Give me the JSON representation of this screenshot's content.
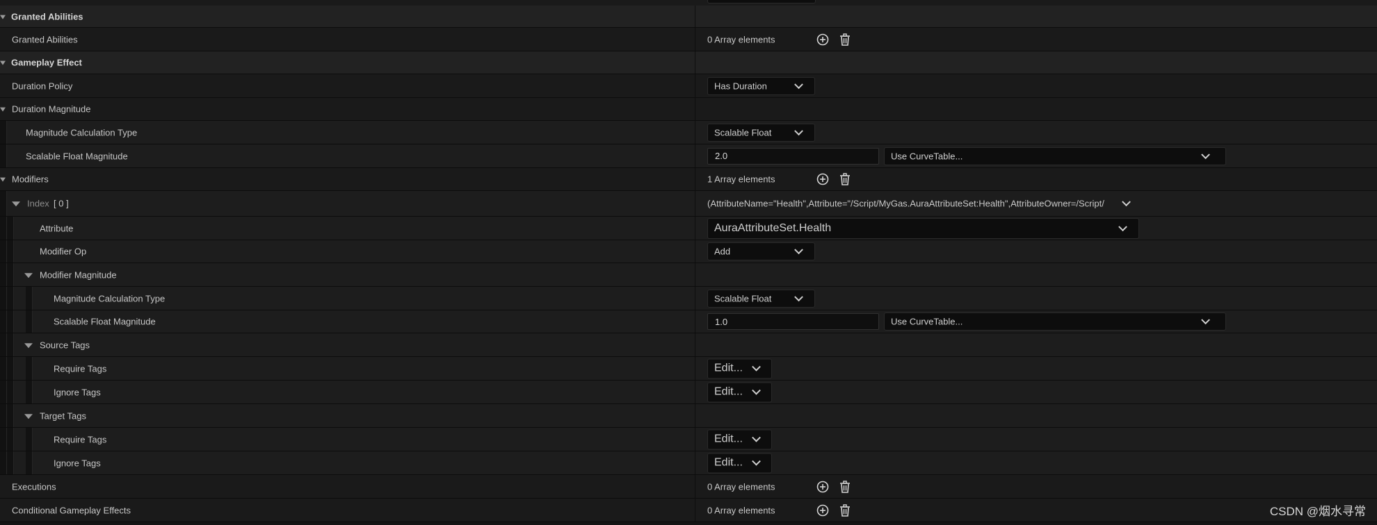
{
  "watermark": "CSDN @烟水寻常",
  "rows": {
    "granted_abilities_category": "Granted Abilities",
    "granted_abilities": {
      "label": "Granted Abilities",
      "value": "0 Array elements"
    },
    "gameplay_effect_category": "Gameplay Effect",
    "duration_policy": {
      "label": "Duration Policy",
      "value": "Has Duration"
    },
    "duration_magnitude": {
      "label": "Duration Magnitude"
    },
    "dm_calc_type": {
      "label": "Magnitude Calculation Type",
      "value": "Scalable Float"
    },
    "dm_scalable_float": {
      "label": "Scalable Float Magnitude",
      "value": "2.0",
      "curve": "Use CurveTable..."
    },
    "modifiers": {
      "label": "Modifiers",
      "value": "1 Array elements"
    },
    "index0": {
      "label": "Index",
      "index_value": "[ 0 ]",
      "value": "(AttributeName=\"Health\",Attribute=\"/Script/MyGas.AuraAttributeSet:Health\",AttributeOwner=/Script/"
    },
    "attribute": {
      "label": "Attribute",
      "value": "AuraAttributeSet.Health"
    },
    "modifier_op": {
      "label": "Modifier Op",
      "value": "Add"
    },
    "modifier_magnitude": {
      "label": "Modifier Magnitude"
    },
    "mm_calc_type": {
      "label": "Magnitude Calculation Type",
      "value": "Scalable Float"
    },
    "mm_scalable_float": {
      "label": "Scalable Float Magnitude",
      "value": "1.0",
      "curve": "Use CurveTable..."
    },
    "source_tags": {
      "label": "Source Tags"
    },
    "src_require": {
      "label": "Require Tags",
      "value": "Edit..."
    },
    "src_ignore": {
      "label": "Ignore Tags",
      "value": "Edit..."
    },
    "target_tags": {
      "label": "Target Tags"
    },
    "tgt_require": {
      "label": "Require Tags",
      "value": "Edit..."
    },
    "tgt_ignore": {
      "label": "Ignore Tags",
      "value": "Edit..."
    },
    "executions": {
      "label": "Executions",
      "value": "0 Array elements"
    },
    "conditional_effects": {
      "label": "Conditional Gameplay Effects",
      "value": "0 Array elements"
    }
  }
}
